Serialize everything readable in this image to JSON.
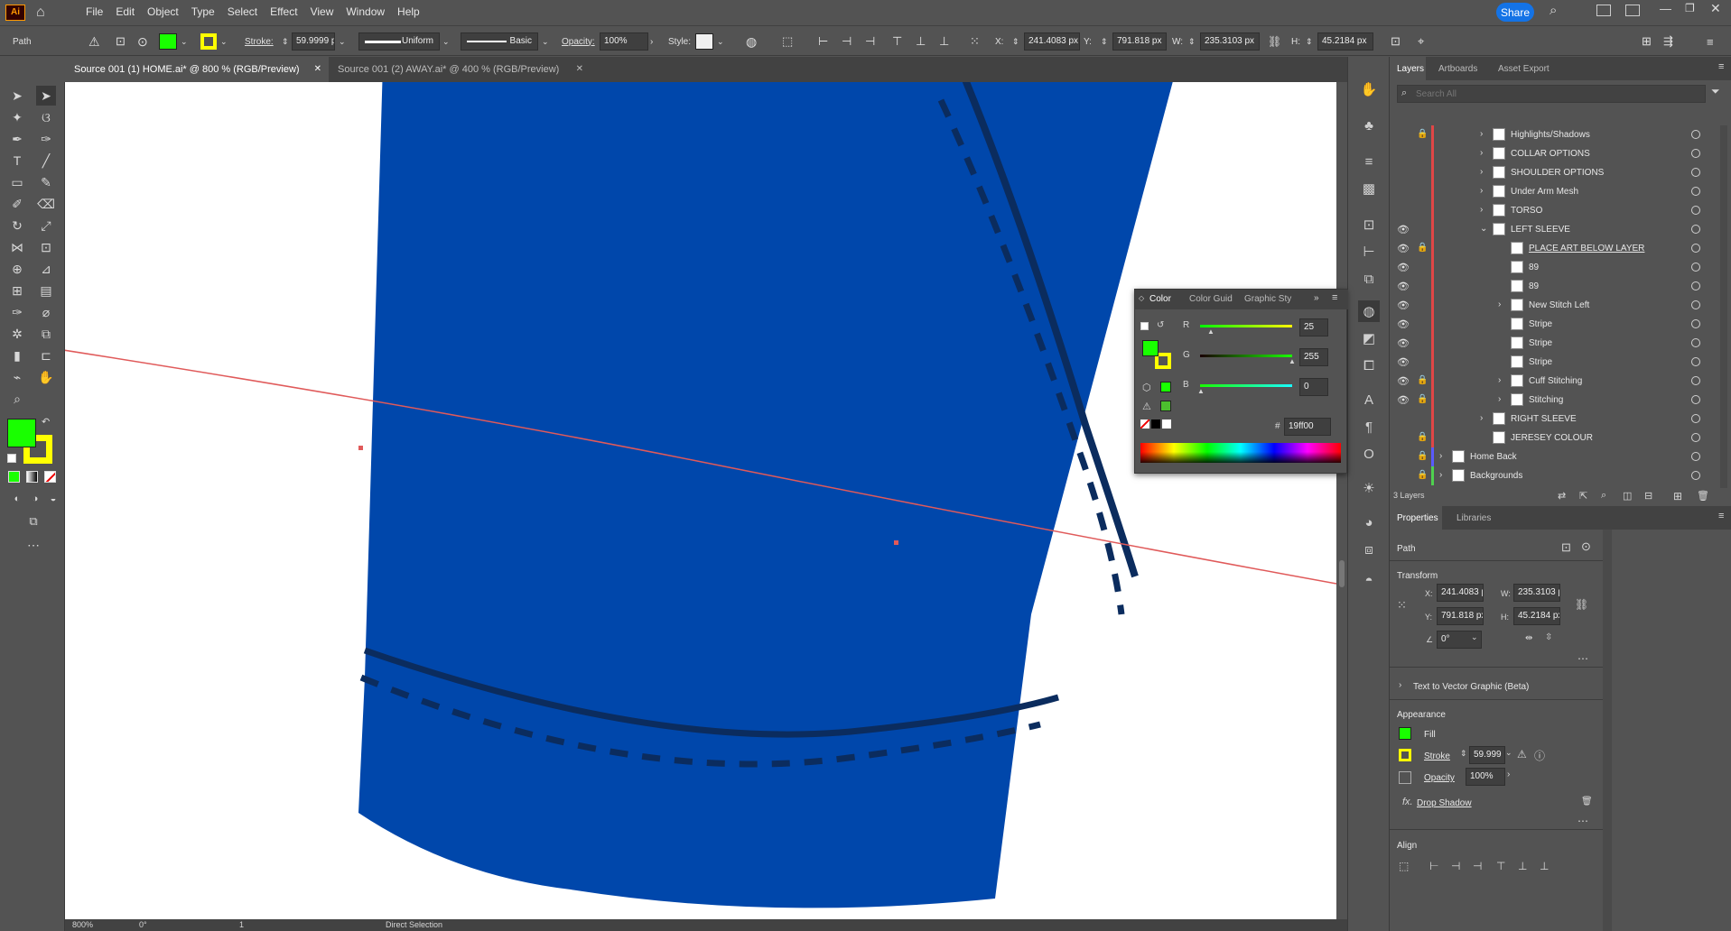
{
  "app": {
    "logo": "Ai"
  },
  "menu": [
    "File",
    "Edit",
    "Object",
    "Type",
    "Select",
    "Effect",
    "View",
    "Window",
    "Help"
  ],
  "share_label": "Share",
  "control": {
    "object_type": "Path",
    "stroke_label": "Stroke:",
    "stroke_value": "59.9999 p",
    "uniform_label": "Uniform",
    "basic_label": "Basic",
    "opacity_label": "Opacity:",
    "opacity_value": "100%",
    "style_label": "Style:",
    "x_label": "X:",
    "x_value": "241.4083 px",
    "y_label": "Y:",
    "y_value": "791.818 px",
    "w_label": "W:",
    "w_value": "235.3103 px",
    "h_label": "H:",
    "h_value": "45.2184 px"
  },
  "tabs": [
    {
      "label": "Source 001 (1) HOME.ai* @ 800 % (RGB/Preview)",
      "active": true
    },
    {
      "label": "Source 001 (2) AWAY.ai* @ 400 % (RGB/Preview)",
      "active": false
    }
  ],
  "colors": {
    "fill": "#19ff00",
    "stroke": "#ffff00",
    "jersey_blue": "#0047ab",
    "stitch": "#0b2c5e",
    "path_red": "#e05a5a",
    "layer_red": "#e04646"
  },
  "status": {
    "zoom": "800%",
    "angle": "0°",
    "artboard": "1",
    "tool": "Direct Selection"
  },
  "color_panel": {
    "tabs": [
      "Color",
      "Color Guid",
      "Graphic Sty"
    ],
    "r_label": "R",
    "r_value": "25",
    "g_label": "G",
    "g_value": "255",
    "b_label": "B",
    "b_value": "0",
    "hex_label": "#",
    "hex_value": "19ff00"
  },
  "layers_panel": {
    "tabs": [
      "Layers",
      "Artboards",
      "Asset Export"
    ],
    "search_placeholder": "Search All",
    "rows": [
      {
        "name": "Highlights/Shadows",
        "eye": false,
        "lock": true,
        "depth": 1,
        "chev": "right"
      },
      {
        "name": "COLLAR OPTIONS",
        "eye": false,
        "lock": false,
        "depth": 1,
        "chev": "right"
      },
      {
        "name": "SHOULDER OPTIONS",
        "eye": false,
        "lock": false,
        "depth": 1,
        "chev": "right"
      },
      {
        "name": "Under Arm Mesh",
        "eye": false,
        "lock": false,
        "depth": 1,
        "chev": "right"
      },
      {
        "name": "TORSO",
        "eye": false,
        "lock": false,
        "depth": 1,
        "chev": "right"
      },
      {
        "name": "LEFT SLEEVE",
        "eye": true,
        "lock": false,
        "depth": 1,
        "chev": "down"
      },
      {
        "name": "PLACE ART BELOW LAYER",
        "eye": true,
        "lock": true,
        "depth": 2,
        "chev": "none"
      },
      {
        "name": "89",
        "eye": true,
        "lock": false,
        "depth": 2,
        "chev": "none"
      },
      {
        "name": "89",
        "eye": true,
        "lock": false,
        "depth": 2,
        "chev": "none"
      },
      {
        "name": "New Stitch Left",
        "eye": true,
        "lock": false,
        "depth": 2,
        "chev": "right"
      },
      {
        "name": "Stripe",
        "eye": true,
        "lock": false,
        "depth": 2,
        "chev": "none"
      },
      {
        "name": "Stripe",
        "eye": true,
        "lock": false,
        "depth": 2,
        "chev": "none"
      },
      {
        "name": "Stripe",
        "eye": true,
        "lock": false,
        "depth": 2,
        "chev": "none"
      },
      {
        "name": "Cuff Stitching",
        "eye": true,
        "lock": true,
        "depth": 2,
        "chev": "right"
      },
      {
        "name": "Stitching",
        "eye": true,
        "lock": true,
        "depth": 2,
        "chev": "right"
      },
      {
        "name": "RIGHT SLEEVE",
        "eye": false,
        "lock": false,
        "depth": 1,
        "chev": "right"
      },
      {
        "name": "JERESEY COLOUR",
        "eye": false,
        "lock": true,
        "depth": 1,
        "chev": "none"
      },
      {
        "name": "Home Back",
        "eye": false,
        "lock": true,
        "depth": 0,
        "chev": "right"
      },
      {
        "name": "Backgrounds",
        "eye": false,
        "lock": true,
        "depth": 0,
        "chev": "right"
      }
    ],
    "footer": "3 Layers"
  },
  "properties": {
    "tabs": [
      "Properties",
      "Libraries"
    ],
    "object": "Path",
    "transform_label": "Transform",
    "x_label": "X:",
    "x_value": "241.4083 p",
    "y_label": "Y:",
    "y_value": "791.818 px",
    "w_label": "W:",
    "w_value": "235.3103 p",
    "h_label": "H:",
    "h_value": "45.2184 px",
    "angle_value": "0°",
    "text_to_vector": "Text to Vector Graphic (Beta)",
    "appearance_label": "Appearance",
    "fill_label": "Fill",
    "stroke_label": "Stroke",
    "stroke_value": "59.999",
    "opacity_label": "Opacity",
    "opacity_value": "100%",
    "drop_shadow": "Drop Shadow",
    "align_label": "Align"
  }
}
